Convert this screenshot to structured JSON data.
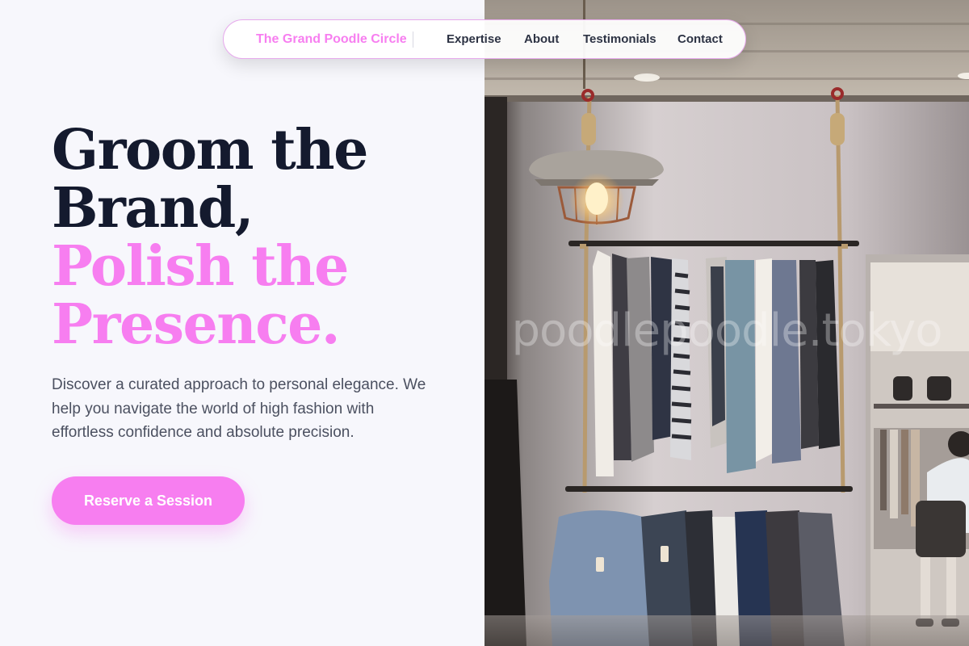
{
  "nav": {
    "brand": "The Grand Poodle Circle",
    "links": [
      "Expertise",
      "About",
      "Testimonials",
      "Contact"
    ]
  },
  "hero": {
    "title_lines": [
      "Groom the",
      "Brand,"
    ],
    "highlight_lines": [
      "Polish the",
      "Presence."
    ],
    "description": "Discover a curated approach to personal elegance. We help you navigate the world of high fashion with effortless confidence and absolute precision.",
    "cta_label": "Reserve a Session"
  },
  "image": {
    "watermark": "poodlepoodle.tokyo"
  },
  "colors": {
    "accent": "#f77ef0",
    "heading": "#141a2e",
    "body_text": "#4b5060",
    "background": "#f7f7fc"
  }
}
